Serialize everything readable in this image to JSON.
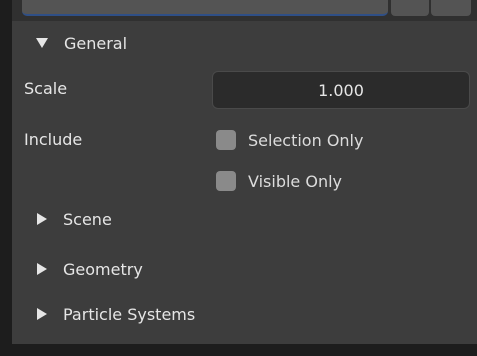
{
  "panel": {
    "general_label": "General",
    "scale": {
      "label": "Scale",
      "value": "1.000"
    },
    "include": {
      "label": "Include",
      "options": [
        {
          "label": "Selection Only",
          "checked": false
        },
        {
          "label": "Visible Only",
          "checked": false
        }
      ]
    },
    "sections": [
      {
        "label": "Scene",
        "expanded": false
      },
      {
        "label": "Geometry",
        "expanded": false
      },
      {
        "label": "Particle Systems",
        "expanded": false
      }
    ]
  },
  "colors": {
    "panel_bg": "#3d3d3d",
    "field_bg": "#2b2b2b",
    "checkbox": "#8a8a8a",
    "accent": "#2f4f86"
  }
}
